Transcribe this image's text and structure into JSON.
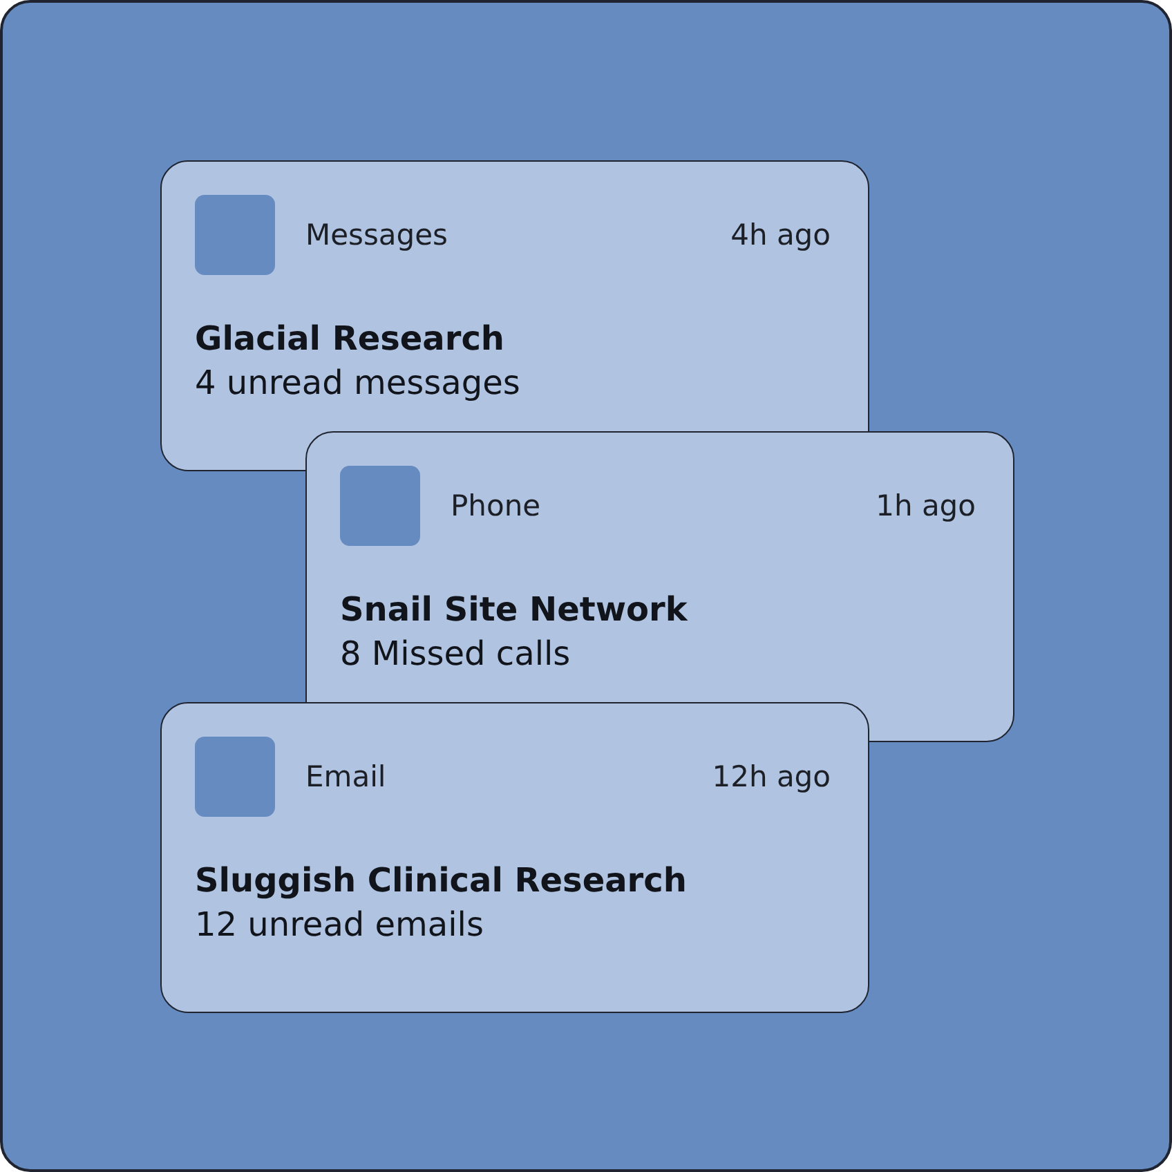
{
  "notifications": [
    {
      "app": "Messages",
      "time": "4h ago",
      "title": "Glacial Research",
      "body": "4 unread messages"
    },
    {
      "app": "Phone",
      "time": "1h ago",
      "title": "Snail Site Network",
      "body": "8 Missed calls"
    },
    {
      "app": "Email",
      "time": "12h ago",
      "title": "Sluggish Clinical Research",
      "body": "12 unread emails"
    }
  ]
}
